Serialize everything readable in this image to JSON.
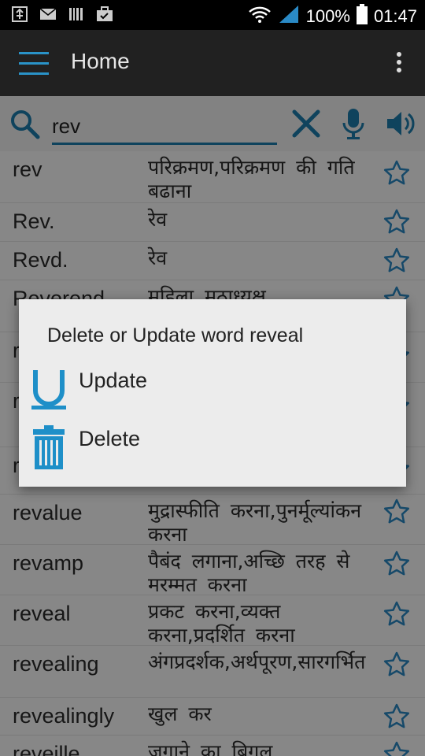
{
  "status_bar": {
    "battery": "100%",
    "time": "01:47",
    "left_icons": [
      "usb-icon",
      "mail-icon",
      "barcode-icon",
      "bag-icon"
    ],
    "right_icons": [
      "wifi-icon",
      "signal-icon",
      "battery-icon"
    ]
  },
  "app_bar": {
    "title": "Home",
    "menu_icon": "hamburger-icon",
    "overflow_icon": "overflow-menu-icon"
  },
  "search": {
    "value": "rev",
    "icons": [
      "search-icon",
      "clear-icon",
      "mic-icon",
      "speaker-icon"
    ]
  },
  "words": [
    {
      "en": "rev",
      "hi": "परिक्रमण,परिक्रमण की गति बढाना"
    },
    {
      "en": "Rev.",
      "hi": "रेव"
    },
    {
      "en": "Revd.",
      "hi": "रेव"
    },
    {
      "en": "Reverend",
      "hi": "महिला मठाध्यक्ष"
    },
    {
      "en": "r",
      "hi": ""
    },
    {
      "en": "r",
      "hi": ""
    },
    {
      "en": "r",
      "hi": ""
    },
    {
      "en": "revalue",
      "hi": "मुद्रास्फीति करना,पुनर्मूल्यांकन करना"
    },
    {
      "en": "revamp",
      "hi": "पैबंद लगाना,अच्छि तरह से मरम्मत करना"
    },
    {
      "en": "reveal",
      "hi": "प्रकट करना,व्यक्त करना,प्रदर्शित करना"
    },
    {
      "en": "revealing",
      "hi": "अंगप्रदर्शक,अर्थपूरण,सारगर्भित"
    },
    {
      "en": "revealingly",
      "hi": "खुल कर"
    },
    {
      "en": "reveille",
      "hi": "जगाने का बिगुल"
    }
  ],
  "dialog": {
    "title": "Delete or Update word reveal",
    "options": [
      {
        "label": "Update",
        "icon": "update-u-icon"
      },
      {
        "label": "Delete",
        "icon": "trash-icon"
      }
    ]
  },
  "colors": {
    "accent": "#1e7fb0",
    "app_bar": "#212121",
    "star": "#2a8ac6",
    "dialog_bg": "#ececec"
  }
}
